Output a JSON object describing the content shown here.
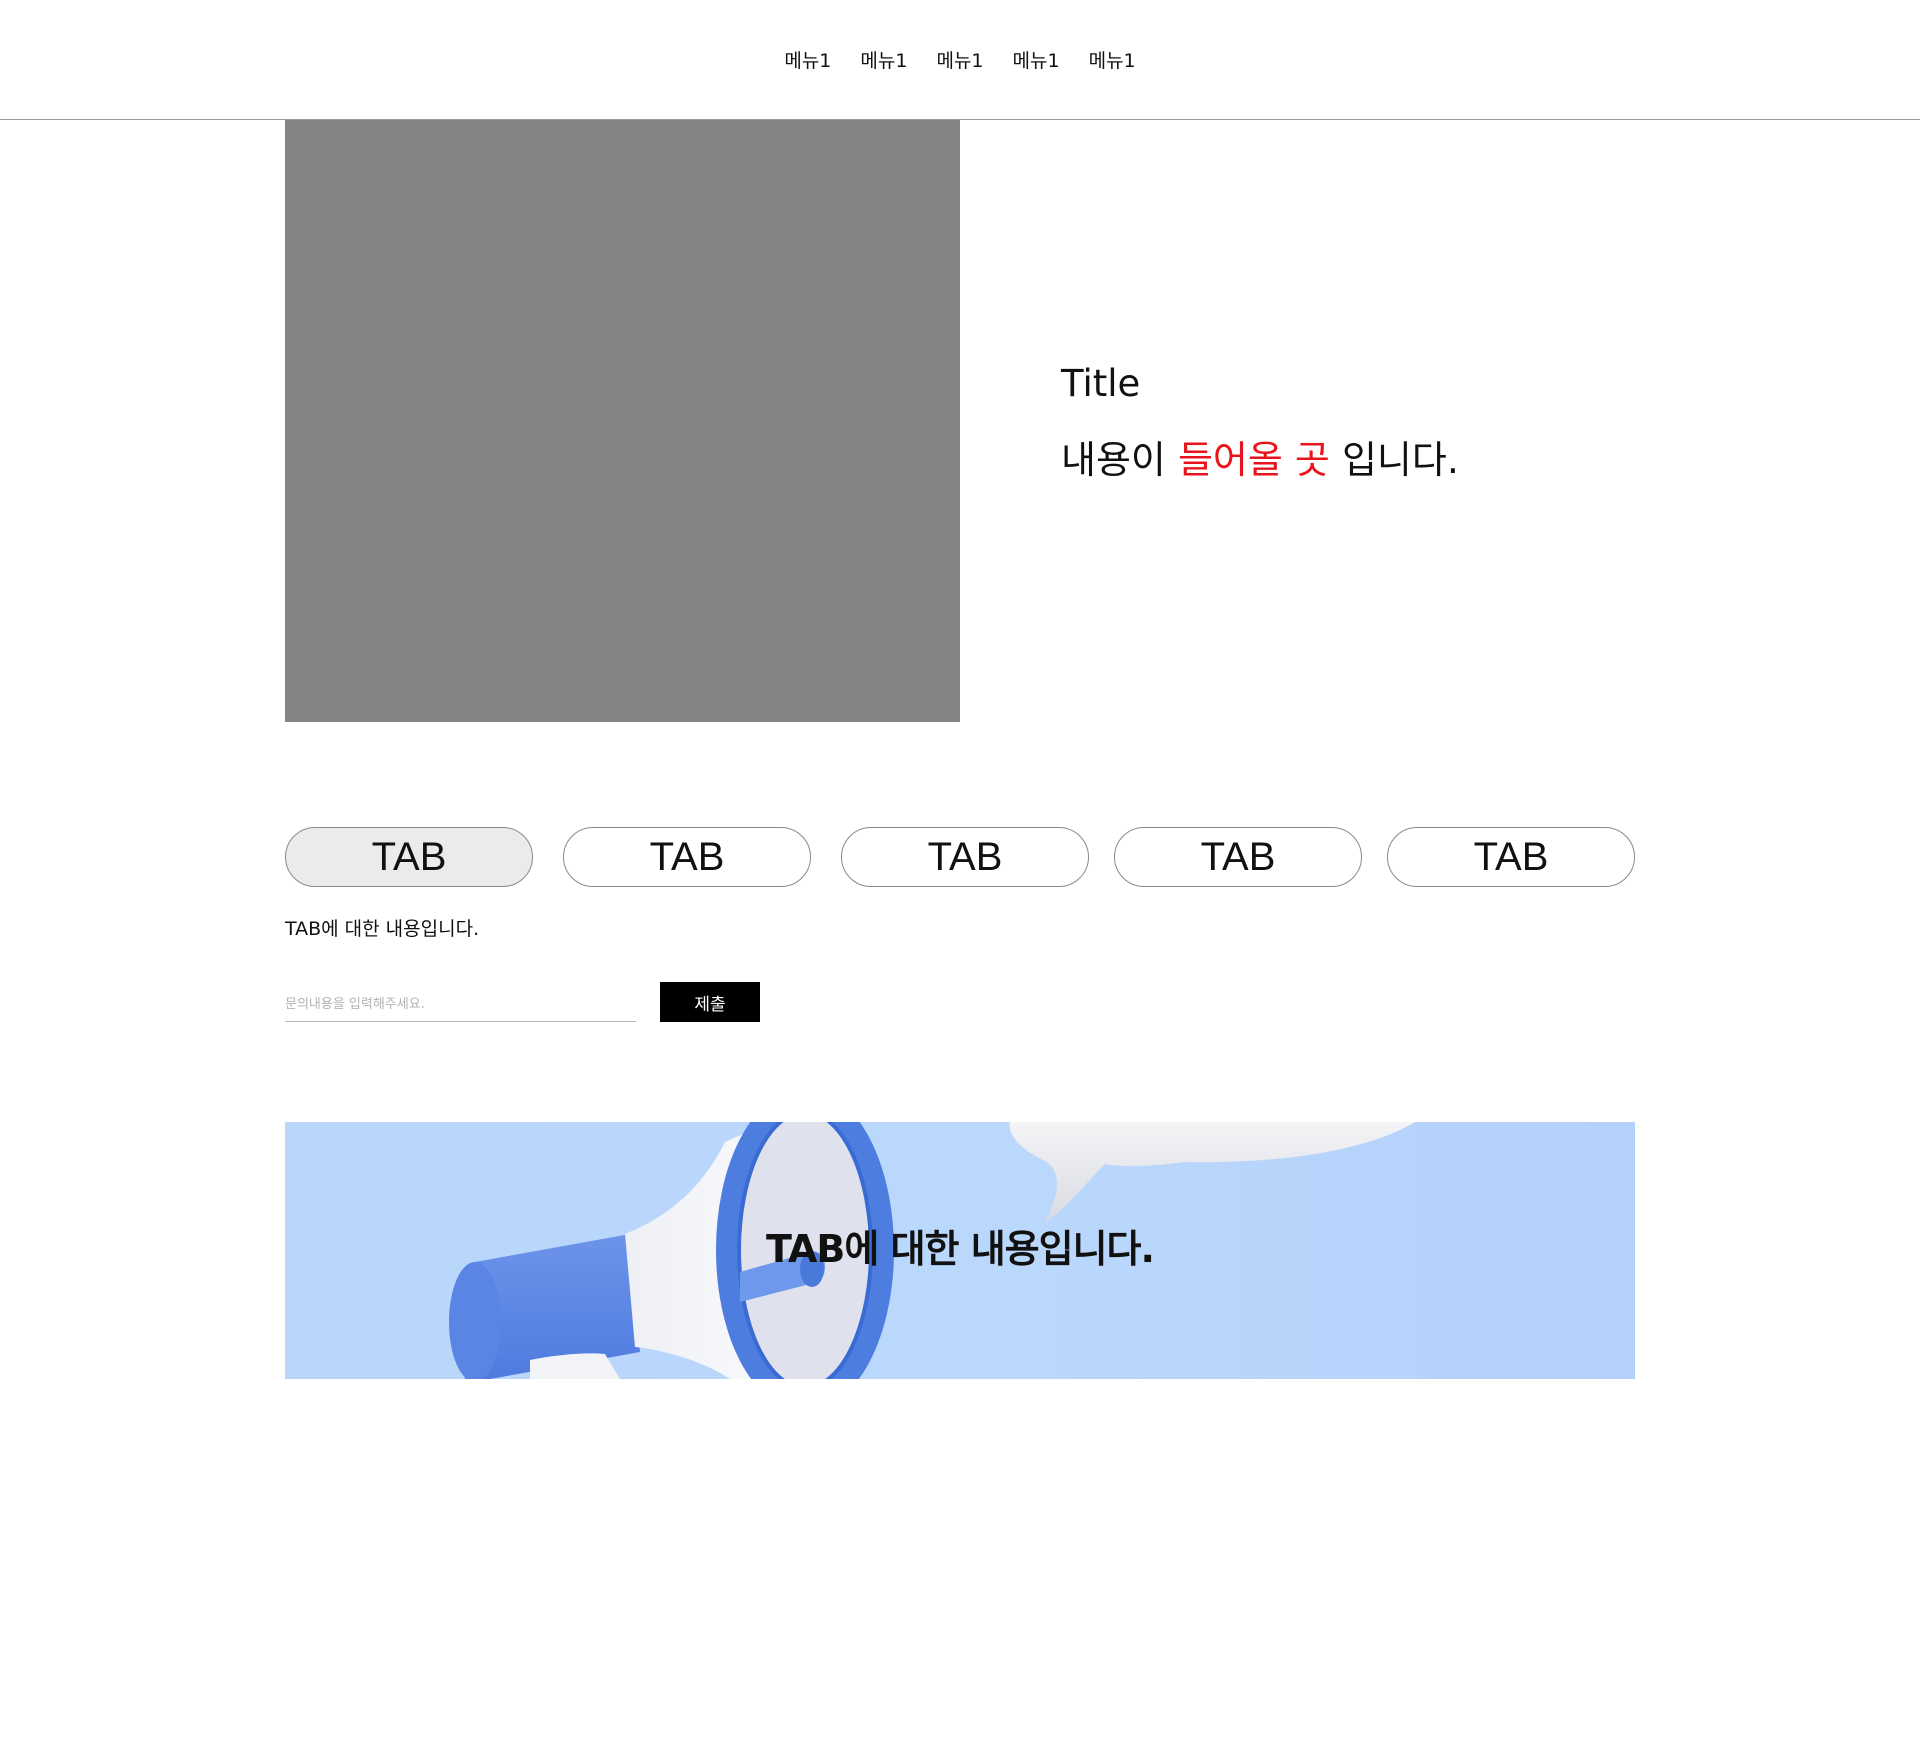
{
  "nav": {
    "items": [
      "메뉴1",
      "메뉴1",
      "메뉴1",
      "메뉴1",
      "메뉴1"
    ]
  },
  "hero": {
    "title": "Title",
    "text_before": "내용이 ",
    "text_highlight": "들어올 곳",
    "text_after": " 입니다.",
    "highlight_color": "#e8141b",
    "image_placeholder_color": "#848484"
  },
  "tabs": {
    "labels": [
      "TAB",
      "TAB",
      "TAB",
      "TAB",
      "TAB"
    ],
    "active_index": 0,
    "content": "TAB에 대한 내용입니다."
  },
  "inquiry": {
    "placeholder": "문의내용을 입력해주세요.",
    "value": "",
    "submit_label": "제출"
  },
  "banner": {
    "text": "TAB에 대한 내용입니다.",
    "background_color": "#bad7fc",
    "image_icon": "megaphone-icon"
  }
}
